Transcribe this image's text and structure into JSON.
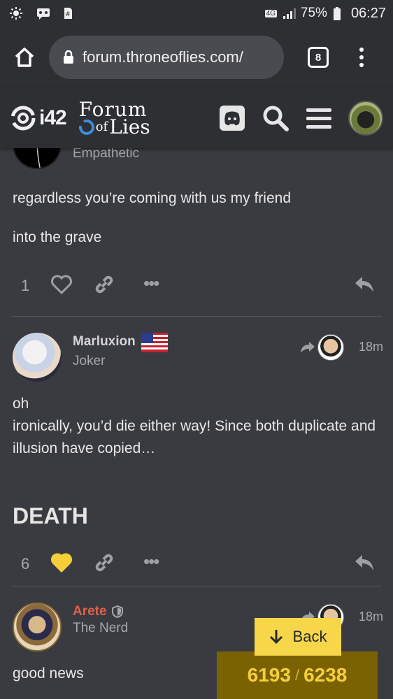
{
  "status_bar": {
    "battery": "75%",
    "time": "06:27",
    "network": "4G"
  },
  "browser": {
    "url": "forum.throneoflies.com/",
    "tab_count": "8"
  },
  "site_header": {
    "logo_left": "i42",
    "logo_right_line1": "Forum",
    "logo_right_line2_prefix": "of",
    "logo_right_line2": "Lies"
  },
  "posts": [
    {
      "role": "Empathetic",
      "paragraphs": [
        "regardless you’re coming with us my friend",
        "into the grave"
      ],
      "like_count": "1"
    },
    {
      "username": "Marluxion",
      "role": "Joker",
      "time": "18m",
      "paragraphs": [
        "oh",
        "ironically, you’d die either way! Since both duplicate and illusion have copied…"
      ],
      "heading": "DEATH",
      "like_count": "6"
    },
    {
      "username": "Arete",
      "role": "The Nerd",
      "time": "18m",
      "paragraphs": [
        "good news"
      ]
    }
  ],
  "controls": {
    "back_label": "Back",
    "progress_current": "6193",
    "progress_separator": "/",
    "progress_total": "6238"
  },
  "colors": {
    "background": "#3a3b40",
    "header": "#2e2f33",
    "accent_yellow": "#f7d64a",
    "liked_heart": "#f5cf3a",
    "username_red": "#e0614a"
  }
}
